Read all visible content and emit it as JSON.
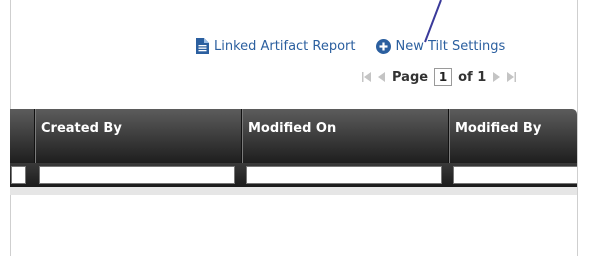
{
  "header": {
    "linked_report_label": "Linked Artifact Report",
    "new_settings_label": "New Tilt Settings"
  },
  "pager": {
    "page_label": "Page",
    "current_page": "1",
    "of_label": "of 1"
  },
  "grid": {
    "columns": [
      "Created By",
      "Modified On",
      "Modified By"
    ]
  },
  "icons": {
    "report": "document-icon",
    "new": "plus-circle-icon",
    "first": "first-page-icon",
    "prev": "prev-page-icon",
    "next": "next-page-icon",
    "last": "last-page-icon"
  },
  "colors": {
    "link": "#2b5f9f",
    "header_bg": "#2a2a2a",
    "annotation": "#3a3a9a"
  }
}
